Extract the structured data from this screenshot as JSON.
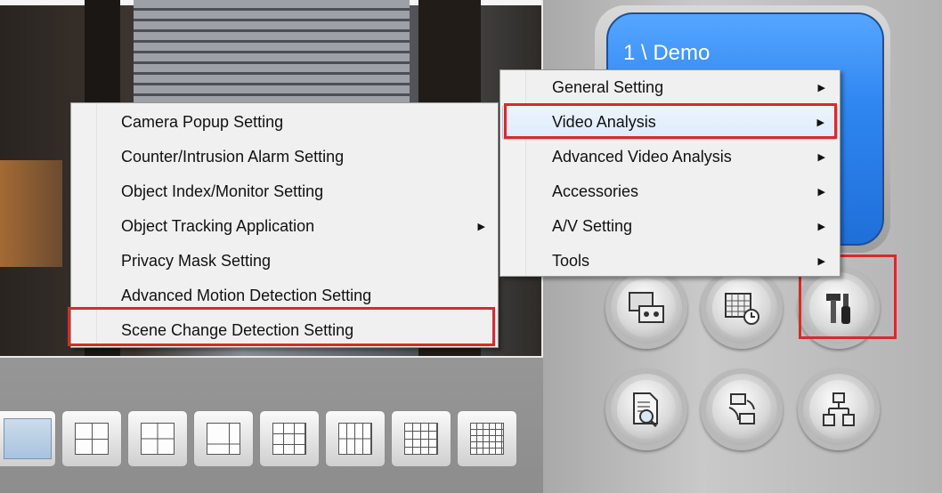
{
  "monitor": {
    "title": "1 \\ Demo"
  },
  "main_menu": {
    "items": [
      {
        "label": "General Setting",
        "submenu": true
      },
      {
        "label": "Video Analysis",
        "submenu": true,
        "active": true
      },
      {
        "label": "Advanced Video Analysis",
        "submenu": true
      },
      {
        "label": "Accessories",
        "submenu": true
      },
      {
        "label": "A/V Setting",
        "submenu": true
      },
      {
        "label": "Tools",
        "submenu": true
      }
    ],
    "arrow": "▶"
  },
  "video_analysis_menu": {
    "items": [
      {
        "label": "Camera Popup Setting"
      },
      {
        "label": "Counter/Intrusion Alarm Setting"
      },
      {
        "label": "Object Index/Monitor Setting"
      },
      {
        "label": "Object Tracking Application",
        "submenu": true
      },
      {
        "label": "Privacy Mask Setting"
      },
      {
        "label": "Advanced Motion Detection Setting"
      },
      {
        "label": "Scene Change Detection Setting",
        "highlighted": true
      }
    ]
  },
  "round_buttons": [
    {
      "name": "playback-icon"
    },
    {
      "name": "schedule-icon"
    },
    {
      "name": "configure-icon"
    },
    {
      "name": "search-log-icon"
    },
    {
      "name": "network-backup-icon"
    },
    {
      "name": "network-icon"
    }
  ],
  "layout_buttons": [
    "single",
    "2x2",
    "2x2",
    "1+5",
    "3x3",
    "1+7",
    "1+12",
    "4x4"
  ],
  "colors": {
    "highlight": "#d62b2b",
    "monitor_blue": "#2f86f1"
  }
}
